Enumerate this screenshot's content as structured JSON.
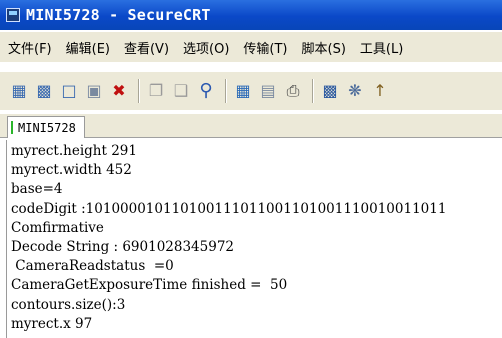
{
  "window": {
    "title": "MINI5728 - SecureCRT"
  },
  "menubar": {
    "items": [
      {
        "label": "文件(F)"
      },
      {
        "label": "编辑(E)"
      },
      {
        "label": "查看(V)"
      },
      {
        "label": "选项(O)"
      },
      {
        "label": "传输(T)"
      },
      {
        "label": "脚本(S)"
      },
      {
        "label": "工具(L)"
      }
    ]
  },
  "toolbar": {
    "icons": [
      "connect-icon",
      "quick-connect-icon",
      "connect-tab-icon",
      "reconnect-icon",
      "disconnect-icon",
      "copy-icon",
      "paste-icon",
      "find-icon",
      "print-setup-icon",
      "print-screen-icon",
      "print-icon",
      "session-options-icon",
      "global-options-icon",
      "help-icon"
    ]
  },
  "tabs": [
    {
      "label": "MINI5728"
    }
  ],
  "terminal": {
    "lines": [
      "myrect.height 291",
      "myrect.width 452",
      "base=4",
      "codeDigit :101000010110100111011001101001110010011011",
      "Comfirmative",
      "Decode String : 6901028345972",
      " CameraReadstatus  =0",
      "CameraGetExposureTime finished =  50",
      "contours.size():3",
      "myrect.x 97"
    ]
  }
}
